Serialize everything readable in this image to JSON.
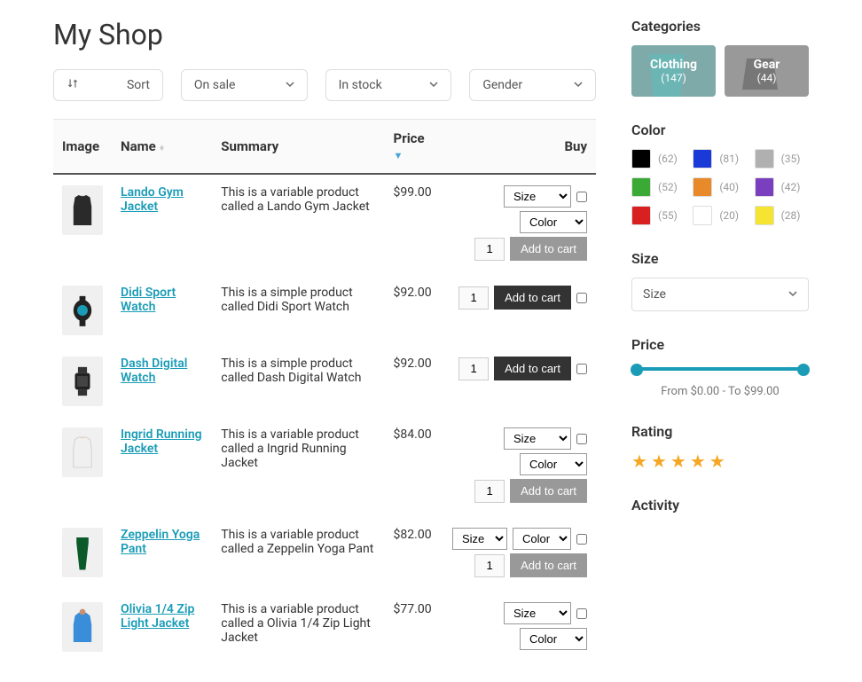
{
  "title": "My Shop",
  "filters": {
    "sort": "Sort",
    "onsale": "On sale",
    "instock": "In stock",
    "gender": "Gender"
  },
  "columns": {
    "image": "Image",
    "name": "Name",
    "summary": "Summary",
    "price": "Price",
    "buy": "Buy"
  },
  "common": {
    "addcart": "Add to cart",
    "size_opt": "Size",
    "color_opt": "Color",
    "qty": "1"
  },
  "products": [
    {
      "name": "Lando Gym Jacket",
      "summary": "This is a variable product called a Lando Gym Jacket",
      "price": "$99.00",
      "variable": true,
      "thumb": "jacket-dark"
    },
    {
      "name": "Didi Sport Watch",
      "summary": "This is a simple product called Didi Sport Watch",
      "price": "$92.00",
      "variable": false,
      "thumb": "watch-round"
    },
    {
      "name": "Dash Digital Watch",
      "summary": "This is a simple product called Dash Digital Watch",
      "price": "$92.00",
      "variable": false,
      "thumb": "watch-square"
    },
    {
      "name": "Ingrid Running Jacket",
      "summary": "This is a variable product called a Ingrid Running Jacket",
      "price": "$84.00",
      "variable": true,
      "thumb": "jacket-white"
    },
    {
      "name": "Zeppelin Yoga Pant",
      "summary": "This is a variable product called a Zeppelin Yoga Pant",
      "price": "$82.00",
      "variable": true,
      "thumb": "pant-green",
      "inline": true
    },
    {
      "name": "Olivia 1/4 Zip Light Jacket",
      "summary": "This is a variable product called a Olivia 1/4 Zip Light Jacket",
      "price": "$77.00",
      "variable": true,
      "thumb": "jacket-blue"
    }
  ],
  "sidebar": {
    "categories_h": "Categories",
    "categories": [
      {
        "name": "Clothing",
        "count": "(147)"
      },
      {
        "name": "Gear",
        "count": "(44)"
      }
    ],
    "color_h": "Color",
    "colors": [
      {
        "hex": "#000000",
        "count": "(62)"
      },
      {
        "hex": "#1a3ad8",
        "count": "(81)"
      },
      {
        "hex": "#b0b0b0",
        "count": "(35)"
      },
      {
        "hex": "#3aa935",
        "count": "(52)"
      },
      {
        "hex": "#e88a2a",
        "count": "(40)"
      },
      {
        "hex": "#7a3fbf",
        "count": "(42)"
      },
      {
        "hex": "#d82020",
        "count": "(55)"
      },
      {
        "hex": "#ffffff",
        "count": "(20)"
      },
      {
        "hex": "#f5e532",
        "count": "(28)"
      }
    ],
    "size_h": "Size",
    "size_sel": "Size",
    "price_h": "Price",
    "price_lbl": "From $0.00 - To $99.00",
    "rating_h": "Rating",
    "activity_h": "Activity"
  }
}
